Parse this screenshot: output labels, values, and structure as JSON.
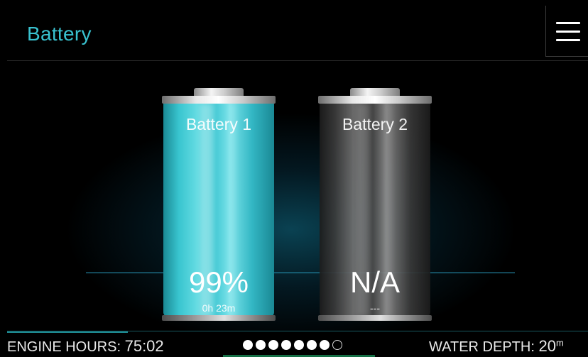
{
  "header": {
    "title": "Battery",
    "menu_icon": "hamburger-menu-icon"
  },
  "batteries": [
    {
      "name": "Battery 1",
      "value": "99%",
      "detail": "0h 23m"
    },
    {
      "name": "Battery 2",
      "value": "N/A",
      "detail": "---"
    }
  ],
  "footer": {
    "engine_label": "ENGINE HOURS:",
    "engine_value": "75:02",
    "depth_label": "WATER DEPTH:",
    "depth_value": "20",
    "depth_unit": "m",
    "page_indicator": {
      "total": 8,
      "current": 7
    }
  },
  "colors": {
    "accent": "#39c2d0",
    "background": "#000000"
  }
}
